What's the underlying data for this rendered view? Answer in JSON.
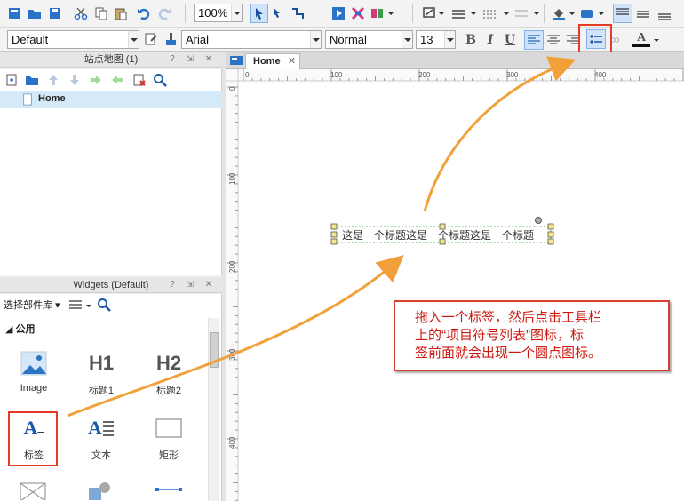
{
  "toolbar": {
    "zoom": "100%",
    "style_select": "Default",
    "font_select": "Arial",
    "weight_select": "Normal",
    "size_select": "13",
    "bold": "B",
    "italic": "I",
    "underline": "U",
    "text_color": "A"
  },
  "sitemap": {
    "title": "站点地图 (1)",
    "pages": [
      "Home"
    ]
  },
  "widgets": {
    "title": "Widgets (Default)",
    "library_select": "选择部件库",
    "category": "公用",
    "items": [
      {
        "label": "Image"
      },
      {
        "label": "标题1",
        "glyph": "H1"
      },
      {
        "label": "标题2",
        "glyph": "H2"
      },
      {
        "label": "标签",
        "glyph": "A"
      },
      {
        "label": "文本",
        "glyph": "A"
      },
      {
        "label": "矩形"
      }
    ]
  },
  "canvas": {
    "tab": "Home",
    "ruler_h": [
      "0",
      "100",
      "200",
      "300",
      "400"
    ],
    "ruler_v": [
      "0",
      "100",
      "200",
      "300",
      "400"
    ],
    "widget_text": "这是一个标题这是一个标题这是一个标题"
  },
  "annotation": {
    "lines": [
      "拖入一个标签，然后点击工具栏",
      "上的“项目符号列表”图标，标",
      "签前面就会出现一个圆点图标。"
    ]
  },
  "colors": {
    "accent": "#e53b26",
    "arrow": "#f2a13a",
    "selection": "#d4eaf8",
    "active_button": "#cfe3fb"
  }
}
